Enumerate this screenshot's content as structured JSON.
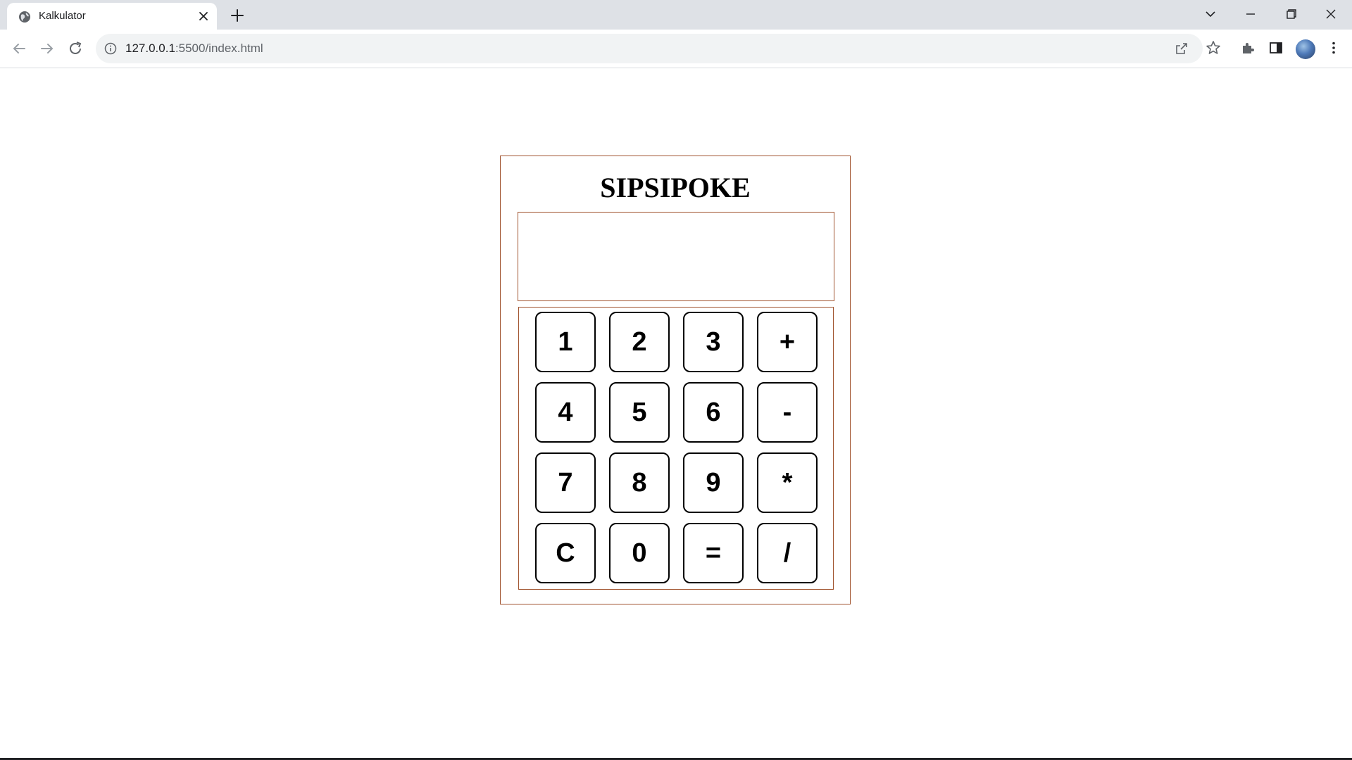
{
  "browser": {
    "tab_title": "Kalkulator",
    "url_host": "127.0.0.1",
    "url_rest": ":5500/index.html",
    "icons": {
      "favicon": "globe-icon",
      "tab_close": "close-icon",
      "new_tab": "plus-icon",
      "tab_search": "chevron-down-icon",
      "minimize": "minimize-icon",
      "restore": "restore-icon",
      "close_window": "close-icon",
      "back": "back-arrow-icon",
      "forward": "forward-arrow-icon",
      "reload": "reload-icon",
      "site_info": "info-icon",
      "share": "share-icon",
      "bookmark": "star-icon",
      "extensions": "puzzle-icon",
      "side_panel": "side-panel-icon",
      "profile": "avatar",
      "menu": "kebab-menu-icon"
    }
  },
  "calculator": {
    "title": "SIPSIPOKE",
    "display_value": "",
    "keys": [
      [
        "1",
        "2",
        "3",
        "+"
      ],
      [
        "4",
        "5",
        "6",
        "-"
      ],
      [
        "7",
        "8",
        "9",
        "*"
      ],
      [
        "C",
        "0",
        "=",
        "/"
      ]
    ],
    "border_color": "#a0522d"
  }
}
